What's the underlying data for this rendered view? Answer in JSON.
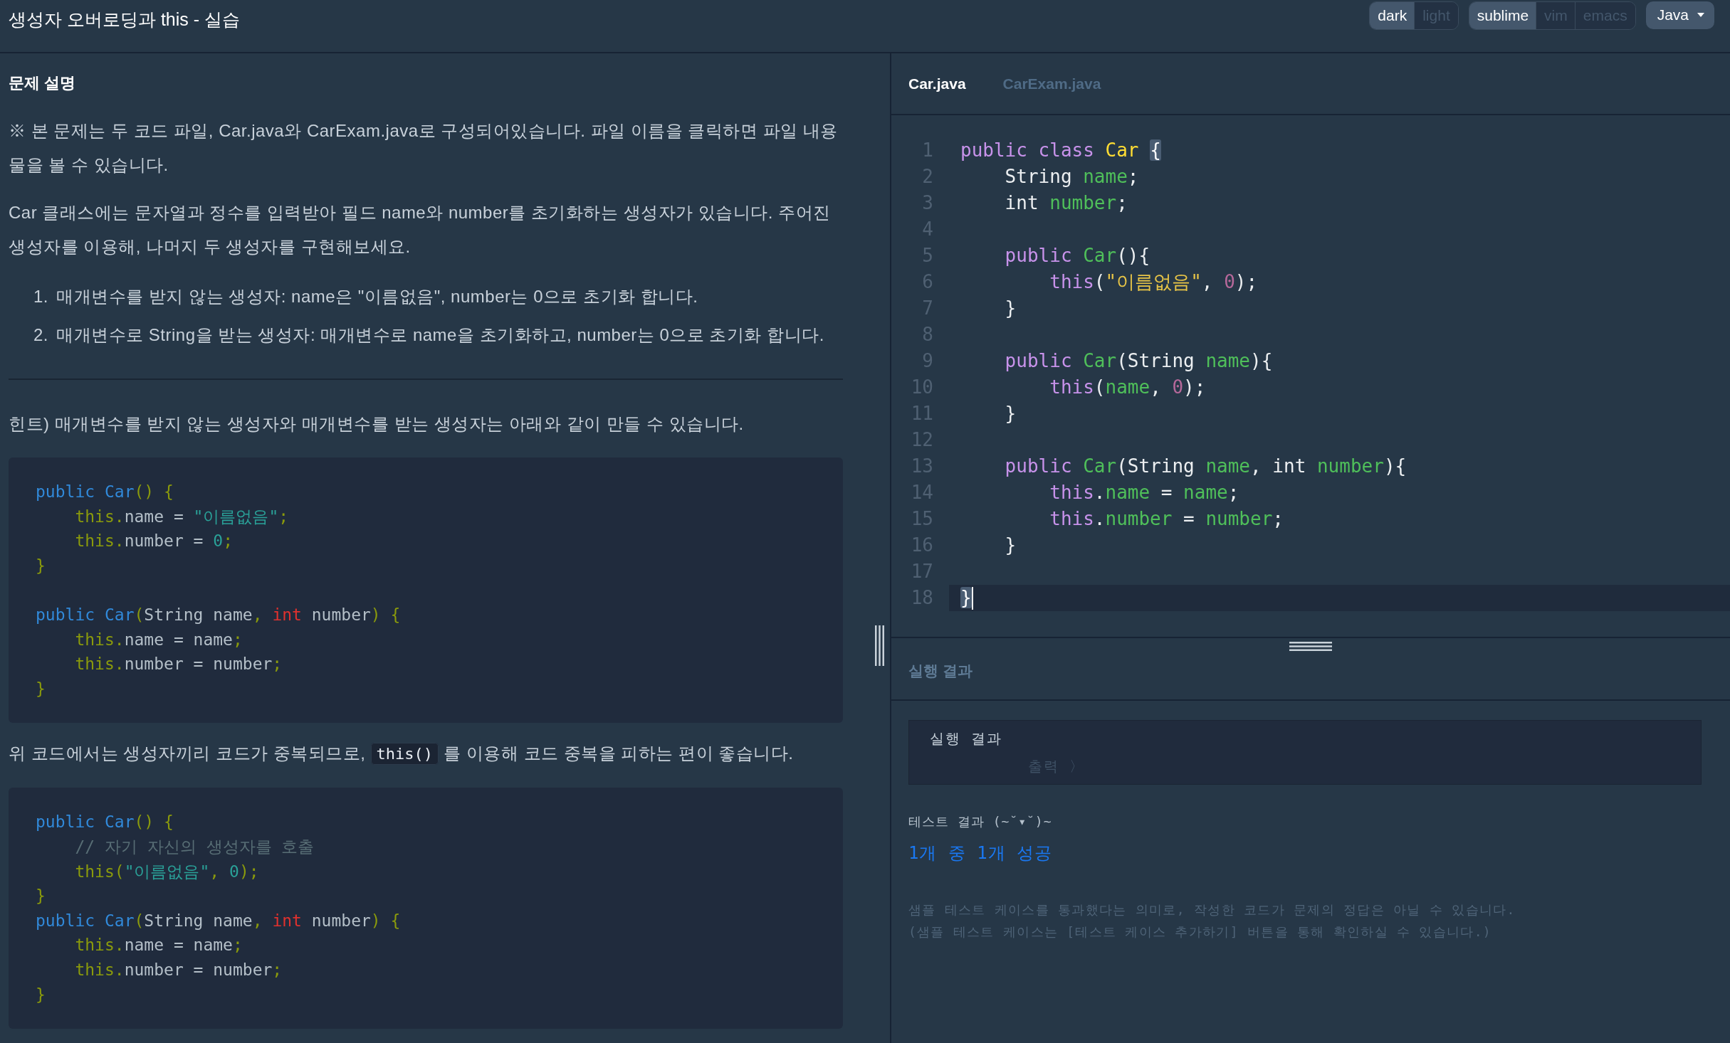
{
  "header": {
    "title": "생성자 오버로딩과 this - 실습",
    "theme_options": [
      {
        "label": "dark",
        "selected": true
      },
      {
        "label": "light",
        "selected": false
      }
    ],
    "keymap_options": [
      {
        "label": "sublime",
        "selected": true
      },
      {
        "label": "vim",
        "selected": false
      },
      {
        "label": "emacs",
        "selected": false
      }
    ],
    "language": "Java"
  },
  "problem": {
    "heading": "문제 설명",
    "blocks": [
      {
        "kind": "paragraph",
        "text": "※ 본 문제는 두 코드 파일, Car.java와 CarExam.java로 구성되어있습니다. 파일 이름을 클릭하면 파일 내용물을 볼 수 있습니다."
      },
      {
        "kind": "paragraph",
        "text": "Car 클래스에는 문자열과 정수를 입력받아 필드 name와 number를 초기화하는 생성자가 있습니다. 주어진 생성자를 이용해, 나머지 두 생성자를 구현해보세요."
      },
      {
        "kind": "ordered_list",
        "items": [
          {
            "number": "1.",
            "text": "매개변수를 받지 않는 생성자: name은 \"이름없음\", number는 0으로 초기화 합니다."
          },
          {
            "number": "2.",
            "text": "매개변수로 String을 받는 생성자: 매개변수로 name을 초기화하고, number는 0으로 초기화 합니다."
          }
        ]
      },
      {
        "kind": "divider"
      },
      {
        "kind": "paragraph",
        "text": "힌트) 매개변수를 받지 않는 생성자와 매개변수를 받는 생성자는 아래와 같이 만들 수 있습니다."
      },
      {
        "kind": "code",
        "lines": [
          {
            "kind": "code",
            "tokens": [
              {
                "kind": "keyword",
                "text": "public"
              },
              {
                "kind": "title",
                "text": " Car"
              },
              {
                "kind": "punct",
                "text": "() {"
              }
            ]
          },
          {
            "kind": "code",
            "tokens": [
              {
                "kind": "builtin",
                "text": "    this"
              },
              {
                "kind": "punct",
                "text": "."
              },
              {
                "kind": "plain",
                "text": "name = "
              },
              {
                "kind": "string",
                "text": "\"이름없음\""
              },
              {
                "kind": "punct",
                "text": ";"
              }
            ]
          },
          {
            "kind": "code",
            "tokens": [
              {
                "kind": "builtin",
                "text": "    this"
              },
              {
                "kind": "punct",
                "text": "."
              },
              {
                "kind": "plain",
                "text": "number = "
              },
              {
                "kind": "number",
                "text": "0"
              },
              {
                "kind": "punct",
                "text": ";"
              }
            ]
          },
          {
            "kind": "code",
            "tokens": [
              {
                "kind": "punct",
                "text": "}"
              }
            ]
          },
          {
            "kind": "blank"
          },
          {
            "kind": "code",
            "tokens": [
              {
                "kind": "keyword",
                "text": "public"
              },
              {
                "kind": "title",
                "text": " Car"
              },
              {
                "kind": "punct",
                "text": "("
              },
              {
                "kind": "plain",
                "text": "String name"
              },
              {
                "kind": "punct",
                "text": ", "
              },
              {
                "kind": "type",
                "text": "int"
              },
              {
                "kind": "plain",
                "text": " number"
              },
              {
                "kind": "punct",
                "text": ") {"
              }
            ]
          },
          {
            "kind": "code",
            "tokens": [
              {
                "kind": "builtin",
                "text": "    this"
              },
              {
                "kind": "punct",
                "text": "."
              },
              {
                "kind": "plain",
                "text": "name = name"
              },
              {
                "kind": "punct",
                "text": ";"
              }
            ]
          },
          {
            "kind": "code",
            "tokens": [
              {
                "kind": "builtin",
                "text": "    this"
              },
              {
                "kind": "punct",
                "text": "."
              },
              {
                "kind": "plain",
                "text": "number = number"
              },
              {
                "kind": "punct",
                "text": ";"
              }
            ]
          },
          {
            "kind": "code",
            "tokens": [
              {
                "kind": "punct",
                "text": "}"
              }
            ]
          }
        ]
      },
      {
        "kind": "paragraph",
        "parts": [
          {
            "kind": "text",
            "text": "위 코드에서는 생성자끼리 코드가 중복되므로, "
          },
          {
            "kind": "code",
            "text": "this()"
          },
          {
            "kind": "text",
            "text": " 를 이용해 코드 중복을 피하는 편이 좋습니다."
          }
        ]
      },
      {
        "kind": "code",
        "lines": [
          {
            "kind": "code",
            "tokens": [
              {
                "kind": "keyword",
                "text": "public"
              },
              {
                "kind": "title",
                "text": " Car"
              },
              {
                "kind": "punct",
                "text": "() {"
              }
            ]
          },
          {
            "kind": "code",
            "tokens": [
              {
                "kind": "comment",
                "text": "    // 자기 자신의 생성자를 호출"
              }
            ]
          },
          {
            "kind": "code",
            "tokens": [
              {
                "kind": "builtin",
                "text": "    this"
              },
              {
                "kind": "punct",
                "text": "("
              },
              {
                "kind": "string",
                "text": "\"이름없음\""
              },
              {
                "kind": "punct",
                "text": ", "
              },
              {
                "kind": "number",
                "text": "0"
              },
              {
                "kind": "punct",
                "text": ");"
              }
            ]
          },
          {
            "kind": "code",
            "tokens": [
              {
                "kind": "punct",
                "text": "}"
              }
            ]
          },
          {
            "kind": "code",
            "tokens": [
              {
                "kind": "keyword",
                "text": "public"
              },
              {
                "kind": "title",
                "text": " Car"
              },
              {
                "kind": "punct",
                "text": "("
              },
              {
                "kind": "plain",
                "text": "String name"
              },
              {
                "kind": "punct",
                "text": ", "
              },
              {
                "kind": "type",
                "text": "int"
              },
              {
                "kind": "plain",
                "text": " number"
              },
              {
                "kind": "punct",
                "text": ") {"
              }
            ]
          },
          {
            "kind": "code",
            "tokens": [
              {
                "kind": "builtin",
                "text": "    this"
              },
              {
                "kind": "punct",
                "text": "."
              },
              {
                "kind": "plain",
                "text": "name = name"
              },
              {
                "kind": "punct",
                "text": ";"
              }
            ]
          },
          {
            "kind": "code",
            "tokens": [
              {
                "kind": "builtin",
                "text": "    this"
              },
              {
                "kind": "punct",
                "text": "."
              },
              {
                "kind": "plain",
                "text": "number = number"
              },
              {
                "kind": "punct",
                "text": ";"
              }
            ]
          },
          {
            "kind": "code",
            "tokens": [
              {
                "kind": "punct",
                "text": "}"
              }
            ]
          }
        ]
      }
    ]
  },
  "editor": {
    "tabs": [
      {
        "label": "Car.java",
        "selected": true
      },
      {
        "label": "CarExam.java",
        "selected": false
      }
    ],
    "lines": [
      {
        "number": "1",
        "active": false,
        "tokens": [
          {
            "kind": "keyword",
            "text": "public class"
          },
          {
            "kind": "class_name",
            "text": " Car "
          },
          {
            "kind": "matched_bracket",
            "text": "{"
          }
        ]
      },
      {
        "number": "2",
        "active": false,
        "tokens": [
          {
            "kind": "plain",
            "text": "    String "
          },
          {
            "kind": "variable",
            "text": "name"
          },
          {
            "kind": "plain",
            "text": ";"
          }
        ]
      },
      {
        "number": "3",
        "active": false,
        "tokens": [
          {
            "kind": "plain",
            "text": "    int "
          },
          {
            "kind": "variable",
            "text": "number"
          },
          {
            "kind": "plain",
            "text": ";"
          }
        ]
      },
      {
        "number": "4",
        "active": false
      },
      {
        "number": "5",
        "active": false,
        "tokens": [
          {
            "kind": "keyword",
            "text": "    public"
          },
          {
            "kind": "function",
            "text": " Car"
          },
          {
            "kind": "plain",
            "text": "(){"
          }
        ]
      },
      {
        "number": "6",
        "active": false,
        "tokens": [
          {
            "kind": "keyword",
            "text": "        this"
          },
          {
            "kind": "plain",
            "text": "("
          },
          {
            "kind": "string",
            "text": "\"이름없음\""
          },
          {
            "kind": "plain",
            "text": ", "
          },
          {
            "kind": "number",
            "text": "0"
          },
          {
            "kind": "plain",
            "text": ");"
          }
        ]
      },
      {
        "number": "7",
        "active": false,
        "tokens": [
          {
            "kind": "plain",
            "text": "    }"
          }
        ]
      },
      {
        "number": "8",
        "active": false
      },
      {
        "number": "9",
        "active": false,
        "tokens": [
          {
            "kind": "keyword",
            "text": "    public"
          },
          {
            "kind": "function",
            "text": " Car"
          },
          {
            "kind": "plain",
            "text": "(String "
          },
          {
            "kind": "variable",
            "text": "name"
          },
          {
            "kind": "plain",
            "text": "){"
          }
        ]
      },
      {
        "number": "10",
        "active": false,
        "tokens": [
          {
            "kind": "keyword",
            "text": "        this"
          },
          {
            "kind": "plain",
            "text": "("
          },
          {
            "kind": "variable",
            "text": "name"
          },
          {
            "kind": "plain",
            "text": ", "
          },
          {
            "kind": "number",
            "text": "0"
          },
          {
            "kind": "plain",
            "text": ");"
          }
        ]
      },
      {
        "number": "11",
        "active": false,
        "tokens": [
          {
            "kind": "plain",
            "text": "    }"
          }
        ]
      },
      {
        "number": "12",
        "active": false
      },
      {
        "number": "13",
        "active": false,
        "tokens": [
          {
            "kind": "keyword",
            "text": "    public"
          },
          {
            "kind": "function",
            "text": " Car"
          },
          {
            "kind": "plain",
            "text": "(String "
          },
          {
            "kind": "variable",
            "text": "name"
          },
          {
            "kind": "plain",
            "text": ", int "
          },
          {
            "kind": "variable",
            "text": "number"
          },
          {
            "kind": "plain",
            "text": "){"
          }
        ]
      },
      {
        "number": "14",
        "active": false,
        "tokens": [
          {
            "kind": "keyword",
            "text": "        this"
          },
          {
            "kind": "plain",
            "text": "."
          },
          {
            "kind": "variable",
            "text": "name"
          },
          {
            "kind": "plain",
            "text": " = "
          },
          {
            "kind": "variable",
            "text": "name"
          },
          {
            "kind": "plain",
            "text": ";"
          }
        ]
      },
      {
        "number": "15",
        "active": false,
        "tokens": [
          {
            "kind": "keyword",
            "text": "        this"
          },
          {
            "kind": "plain",
            "text": "."
          },
          {
            "kind": "variable",
            "text": "number"
          },
          {
            "kind": "plain",
            "text": " = "
          },
          {
            "kind": "variable",
            "text": "number"
          },
          {
            "kind": "plain",
            "text": ";"
          }
        ]
      },
      {
        "number": "16",
        "active": false,
        "tokens": [
          {
            "kind": "plain",
            "text": "    }"
          }
        ]
      },
      {
        "number": "17",
        "active": false
      },
      {
        "number": "18",
        "active": true,
        "tokens": [
          {
            "kind": "matched_bracket",
            "text": "}"
          }
        ]
      }
    ]
  },
  "result": {
    "heading": "실행 결과",
    "console": {
      "title": "실행 결과",
      "prompt": "출력 〉"
    },
    "test_heading": "테스트 결과 (~˘▾˘)~",
    "summary": "1개 중 1개 성공",
    "notes": [
      "샘플 테스트 케이스를 통과했다는 의미로, 작성한 코드가 문제의 정답은 아닐 수 있습니다.",
      "(샘플 테스트 케이스는 [테스트 케이스 추가하기] 버튼을 통해 확인하실 수 있습니다.)"
    ]
  }
}
